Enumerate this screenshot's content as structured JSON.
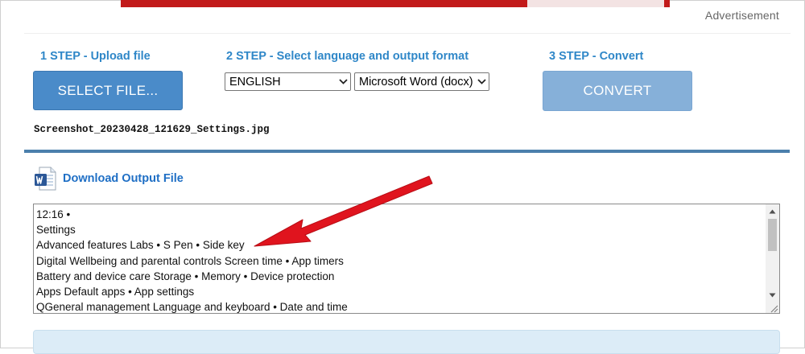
{
  "ad": {
    "label": "Advertisement"
  },
  "steps": {
    "step1": {
      "heading": "1 STEP - Upload file",
      "button_label": "SELECT FILE..."
    },
    "step2": {
      "heading": "2 STEP - Select language and output format",
      "language_selected": "ENGLISH",
      "format_selected": "Microsoft Word (docx)"
    },
    "step3": {
      "heading": "3 STEP - Convert",
      "button_label": "CONVERT"
    }
  },
  "file": {
    "name": "Screenshot_20230428_121629_Settings.jpg"
  },
  "download": {
    "link_label": "Download Output File",
    "icon": "word-doc-icon"
  },
  "output": {
    "lines": [
      "12:16 •",
      "Settings",
      "Advanced features Labs • S Pen • Side key",
      "Digital Wellbeing and parental controls Screen time • App timers",
      "Battery and device care Storage • Memory • Device protection",
      "Apps Default apps • App settings",
      "QGeneral management Language and keyboard • Date and time"
    ]
  },
  "colors": {
    "step_heading": "#2f87c8",
    "select_button": "#4a8bc9",
    "convert_button": "#86b0d9",
    "divider": "#4b7fac",
    "download_link": "#1f6fc5",
    "annotation_arrow": "#e0141e",
    "ad_banner": "#c21a1a"
  }
}
